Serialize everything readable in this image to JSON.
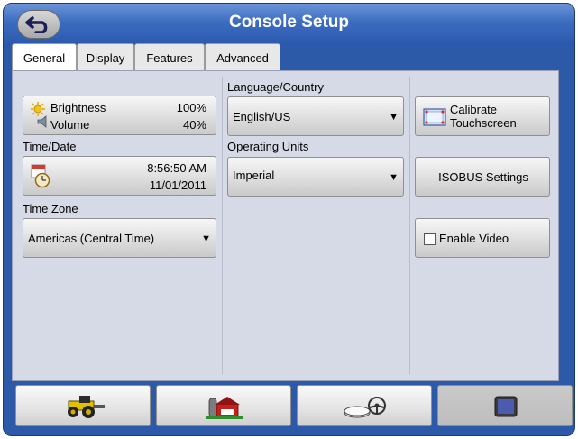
{
  "window": {
    "title": "Console Setup"
  },
  "tabs": [
    "General",
    "Display",
    "Features",
    "Advanced"
  ],
  "general": {
    "brightness_label": "Brightness",
    "brightness_value": "100%",
    "volume_label": "Volume",
    "volume_value": "40%",
    "time_date_label": "Time/Date",
    "time": "8:56:50 AM",
    "date": "11/01/2011",
    "time_zone_label": "Time Zone",
    "time_zone": "Americas (Central Time)"
  },
  "middle": {
    "language_label": "Language/Country",
    "language": "English/US",
    "units_label": "Operating Units",
    "units": "Imperial"
  },
  "right": {
    "calibrate_line1": "Calibrate",
    "calibrate_line2": "Touchscreen",
    "isobus": "ISOBUS Settings",
    "enable_video": "Enable Video"
  },
  "navbar": {
    "buttons": [
      "tractor-icon",
      "farm-icon",
      "steering-icon",
      "display-icon"
    ],
    "active_index": 3
  },
  "colors": {
    "titlebar": "#2a58ad",
    "panel": "#d6d9e6",
    "frame": "#2c5aa8"
  }
}
